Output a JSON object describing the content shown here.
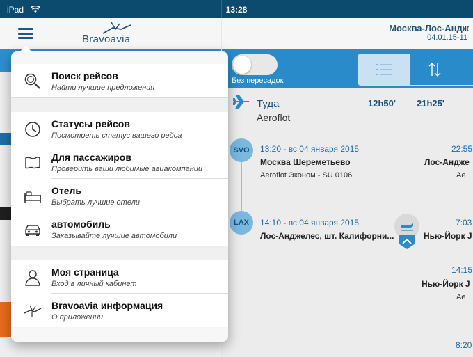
{
  "status_bar": {
    "carrier": "iPad",
    "time": "13:28"
  },
  "app": {
    "logo_text": "Bravoavia"
  },
  "header": {
    "route": "Москва-Лос-Андж",
    "date": "04.01.15-11"
  },
  "filters": {
    "nonstop_label": "Без пересадок",
    "nonstop_on": false
  },
  "direction": {
    "label": "Туда",
    "airline": "Aeroflot",
    "duration_1": "12h50'",
    "duration_2": "21h25'"
  },
  "segments": [
    {
      "code": "SVO",
      "time": "13:20 - вс 04 января 2015",
      "place": "Москва Шереметьево",
      "flight": "Aeroflot Эконом - SU 0106"
    },
    {
      "code": "LAX",
      "time": "14:10 - вс 04 января 2015",
      "place": "Лос-Анджелес, шт. Калифорни..."
    }
  ],
  "right_column": [
    {
      "time": "22:55",
      "place": "Лос-Андже",
      "flight": "Ae"
    },
    {
      "time": "7:03",
      "place": "Нью-Йорк J"
    },
    {
      "time": "14:15",
      "place": "Нью-Йорк J",
      "flight": "Ae"
    },
    {
      "time": "8:20"
    }
  ],
  "menu": {
    "items": [
      {
        "title": "Поиск рейсов",
        "subtitle": "Найти лучшие предложения",
        "icon": "search-icon"
      },
      {
        "title": "Статусы рейсов",
        "subtitle": "Посмотреть статус вашего рейса",
        "icon": "clock-icon"
      },
      {
        "title": "Для пассажиров",
        "subtitle": "Проверить ваши любимые авиакомпании",
        "icon": "flag-icon"
      },
      {
        "title": "Отель",
        "subtitle": "Выбрать лучшие отели",
        "icon": "bed-icon"
      },
      {
        "title": "автомобиль",
        "subtitle": "Заказывайте лучшие автомобили",
        "icon": "car-icon"
      },
      {
        "title": "Моя страница",
        "subtitle": "Вход в личный кабинет",
        "icon": "user-icon"
      },
      {
        "title": "Bravoavia информация",
        "subtitle": "О приложении",
        "icon": "bravoavia-logo-icon"
      }
    ]
  },
  "colors": {
    "brand_blue": "#2a8bcb",
    "dark_blue": "#0c4a6e",
    "accent_orange": "#e86c1a"
  }
}
